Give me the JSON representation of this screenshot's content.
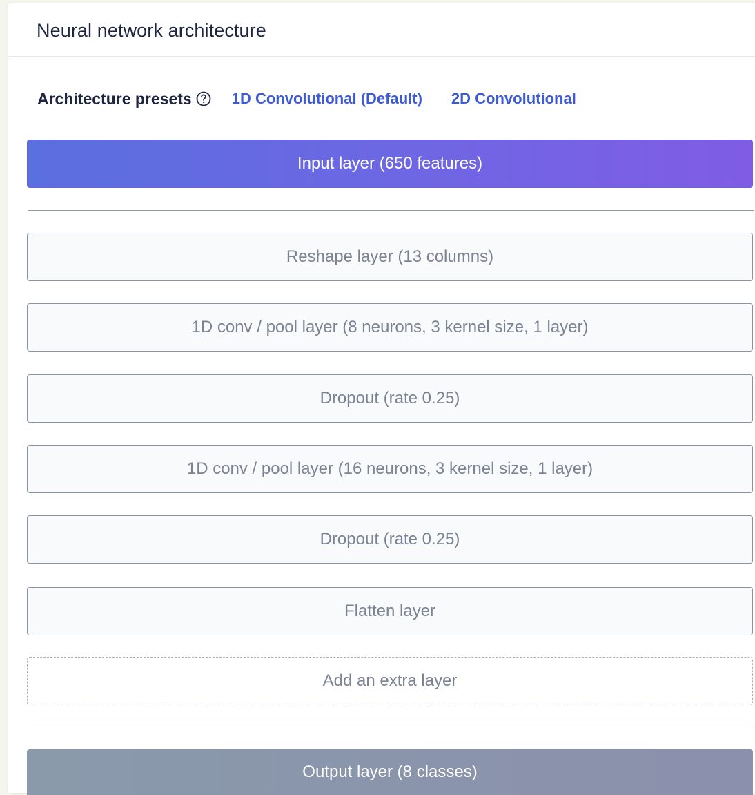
{
  "panel": {
    "title": "Neural network architecture"
  },
  "presets": {
    "label": "Architecture presets",
    "help_icon": "question-circle-icon",
    "options": [
      {
        "label": "1D Convolutional (Default)"
      },
      {
        "label": "2D Convolutional"
      }
    ]
  },
  "input_layer": {
    "label": "Input layer (650 features)"
  },
  "layers": [
    {
      "label": "Reshape layer (13 columns)"
    },
    {
      "label": "1D conv / pool layer (8 neurons, 3 kernel size, 1 layer)"
    },
    {
      "label": "Dropout (rate 0.25)"
    },
    {
      "label": "1D conv / pool layer (16 neurons, 3 kernel size, 1 layer)"
    },
    {
      "label": "Dropout (rate 0.25)"
    },
    {
      "label": "Flatten layer"
    }
  ],
  "add_layer": {
    "label": "Add an extra layer"
  },
  "output_layer": {
    "label": "Output layer (8 classes)"
  },
  "colors": {
    "accent": "#3e5bd6",
    "input_gradient_start": "#5a6fe0",
    "input_gradient_end": "#805ce5",
    "output_gradient_start": "#8a9aab",
    "output_gradient_end": "#8b90ac"
  }
}
